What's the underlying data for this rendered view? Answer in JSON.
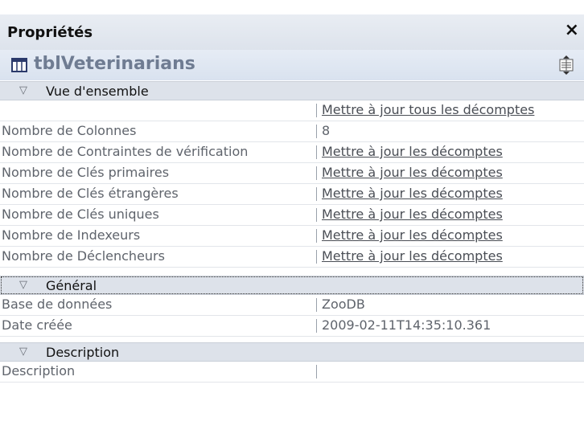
{
  "panel": {
    "title": "Propriétés",
    "close_glyph": "×"
  },
  "object": {
    "name": "tblVeterinarians",
    "icon": "table-icon",
    "action_icon": "properties-toggle-icon"
  },
  "sections": {
    "overview": {
      "label": "Vue d'ensemble",
      "update_all": "Mettre à jour tous les décomptes",
      "rows": [
        {
          "label": "Nombre de Colonnes",
          "value": "8"
        },
        {
          "label": "Nombre de Contraintes de vérification",
          "value": "Mettre à jour les décomptes"
        },
        {
          "label": "Nombre de Clés primaires",
          "value": "Mettre à jour les décomptes"
        },
        {
          "label": "Nombre de Clés étrangères",
          "value": "Mettre à jour les décomptes"
        },
        {
          "label": "Nombre de Clés uniques",
          "value": "Mettre à jour les décomptes"
        },
        {
          "label": "Nombre de Indexeurs",
          "value": "Mettre à jour les décomptes"
        },
        {
          "label": "Nombre de Déclencheurs",
          "value": "Mettre à jour les décomptes"
        }
      ]
    },
    "general": {
      "label": "Général",
      "rows": [
        {
          "label": "Base de données",
          "value": "ZooDB"
        },
        {
          "label": "Date créée",
          "value": "2009-02-11T14:35:10.361"
        }
      ]
    },
    "description": {
      "label": "Description",
      "rows": [
        {
          "label": "Description",
          "value": ""
        }
      ]
    }
  },
  "colors": {
    "header_bg": "#dde3ec",
    "object_bar_bg": "#d9e2ef",
    "section_bg": "#dde2ea",
    "object_name": "#6f7c92"
  }
}
